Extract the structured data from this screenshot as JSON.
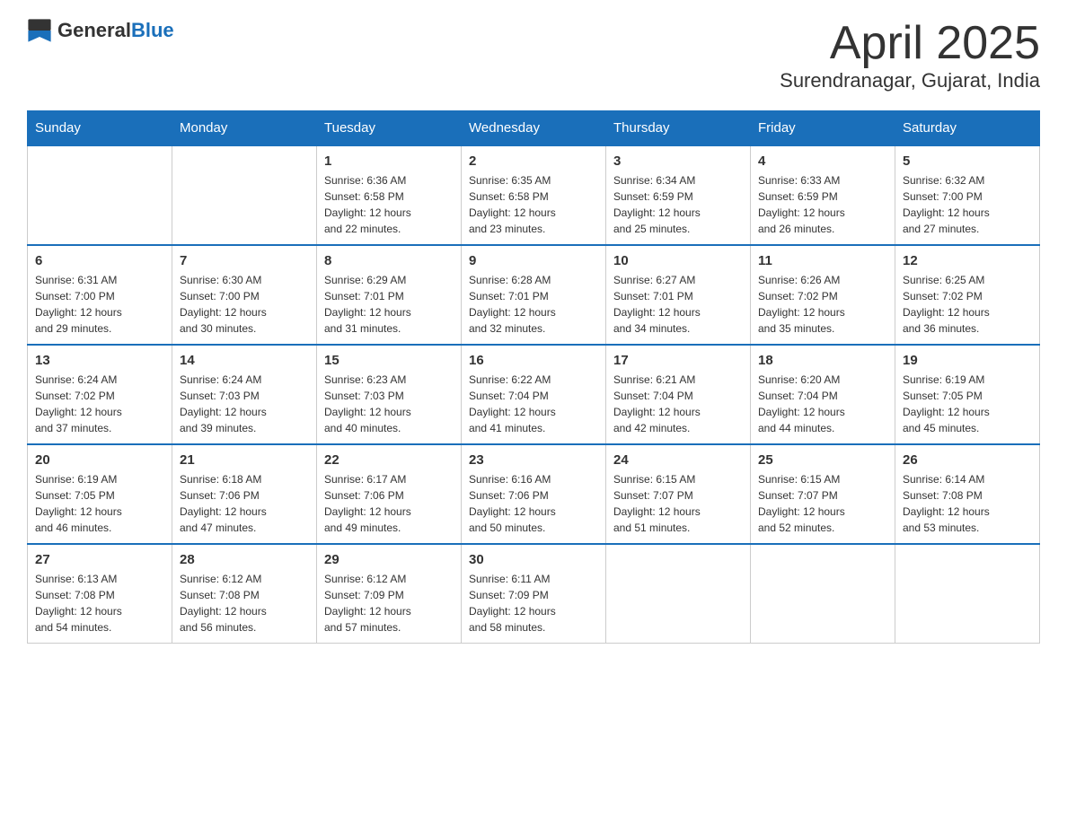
{
  "logo": {
    "text_general": "General",
    "text_blue": "Blue"
  },
  "title": "April 2025",
  "subtitle": "Surendranagar, Gujarat, India",
  "headers": [
    "Sunday",
    "Monday",
    "Tuesday",
    "Wednesday",
    "Thursday",
    "Friday",
    "Saturday"
  ],
  "weeks": [
    [
      {
        "day": "",
        "info": ""
      },
      {
        "day": "",
        "info": ""
      },
      {
        "day": "1",
        "info": "Sunrise: 6:36 AM\nSunset: 6:58 PM\nDaylight: 12 hours\nand 22 minutes."
      },
      {
        "day": "2",
        "info": "Sunrise: 6:35 AM\nSunset: 6:58 PM\nDaylight: 12 hours\nand 23 minutes."
      },
      {
        "day": "3",
        "info": "Sunrise: 6:34 AM\nSunset: 6:59 PM\nDaylight: 12 hours\nand 25 minutes."
      },
      {
        "day": "4",
        "info": "Sunrise: 6:33 AM\nSunset: 6:59 PM\nDaylight: 12 hours\nand 26 minutes."
      },
      {
        "day": "5",
        "info": "Sunrise: 6:32 AM\nSunset: 7:00 PM\nDaylight: 12 hours\nand 27 minutes."
      }
    ],
    [
      {
        "day": "6",
        "info": "Sunrise: 6:31 AM\nSunset: 7:00 PM\nDaylight: 12 hours\nand 29 minutes."
      },
      {
        "day": "7",
        "info": "Sunrise: 6:30 AM\nSunset: 7:00 PM\nDaylight: 12 hours\nand 30 minutes."
      },
      {
        "day": "8",
        "info": "Sunrise: 6:29 AM\nSunset: 7:01 PM\nDaylight: 12 hours\nand 31 minutes."
      },
      {
        "day": "9",
        "info": "Sunrise: 6:28 AM\nSunset: 7:01 PM\nDaylight: 12 hours\nand 32 minutes."
      },
      {
        "day": "10",
        "info": "Sunrise: 6:27 AM\nSunset: 7:01 PM\nDaylight: 12 hours\nand 34 minutes."
      },
      {
        "day": "11",
        "info": "Sunrise: 6:26 AM\nSunset: 7:02 PM\nDaylight: 12 hours\nand 35 minutes."
      },
      {
        "day": "12",
        "info": "Sunrise: 6:25 AM\nSunset: 7:02 PM\nDaylight: 12 hours\nand 36 minutes."
      }
    ],
    [
      {
        "day": "13",
        "info": "Sunrise: 6:24 AM\nSunset: 7:02 PM\nDaylight: 12 hours\nand 37 minutes."
      },
      {
        "day": "14",
        "info": "Sunrise: 6:24 AM\nSunset: 7:03 PM\nDaylight: 12 hours\nand 39 minutes."
      },
      {
        "day": "15",
        "info": "Sunrise: 6:23 AM\nSunset: 7:03 PM\nDaylight: 12 hours\nand 40 minutes."
      },
      {
        "day": "16",
        "info": "Sunrise: 6:22 AM\nSunset: 7:04 PM\nDaylight: 12 hours\nand 41 minutes."
      },
      {
        "day": "17",
        "info": "Sunrise: 6:21 AM\nSunset: 7:04 PM\nDaylight: 12 hours\nand 42 minutes."
      },
      {
        "day": "18",
        "info": "Sunrise: 6:20 AM\nSunset: 7:04 PM\nDaylight: 12 hours\nand 44 minutes."
      },
      {
        "day": "19",
        "info": "Sunrise: 6:19 AM\nSunset: 7:05 PM\nDaylight: 12 hours\nand 45 minutes."
      }
    ],
    [
      {
        "day": "20",
        "info": "Sunrise: 6:19 AM\nSunset: 7:05 PM\nDaylight: 12 hours\nand 46 minutes."
      },
      {
        "day": "21",
        "info": "Sunrise: 6:18 AM\nSunset: 7:06 PM\nDaylight: 12 hours\nand 47 minutes."
      },
      {
        "day": "22",
        "info": "Sunrise: 6:17 AM\nSunset: 7:06 PM\nDaylight: 12 hours\nand 49 minutes."
      },
      {
        "day": "23",
        "info": "Sunrise: 6:16 AM\nSunset: 7:06 PM\nDaylight: 12 hours\nand 50 minutes."
      },
      {
        "day": "24",
        "info": "Sunrise: 6:15 AM\nSunset: 7:07 PM\nDaylight: 12 hours\nand 51 minutes."
      },
      {
        "day": "25",
        "info": "Sunrise: 6:15 AM\nSunset: 7:07 PM\nDaylight: 12 hours\nand 52 minutes."
      },
      {
        "day": "26",
        "info": "Sunrise: 6:14 AM\nSunset: 7:08 PM\nDaylight: 12 hours\nand 53 minutes."
      }
    ],
    [
      {
        "day": "27",
        "info": "Sunrise: 6:13 AM\nSunset: 7:08 PM\nDaylight: 12 hours\nand 54 minutes."
      },
      {
        "day": "28",
        "info": "Sunrise: 6:12 AM\nSunset: 7:08 PM\nDaylight: 12 hours\nand 56 minutes."
      },
      {
        "day": "29",
        "info": "Sunrise: 6:12 AM\nSunset: 7:09 PM\nDaylight: 12 hours\nand 57 minutes."
      },
      {
        "day": "30",
        "info": "Sunrise: 6:11 AM\nSunset: 7:09 PM\nDaylight: 12 hours\nand 58 minutes."
      },
      {
        "day": "",
        "info": ""
      },
      {
        "day": "",
        "info": ""
      },
      {
        "day": "",
        "info": ""
      }
    ]
  ]
}
